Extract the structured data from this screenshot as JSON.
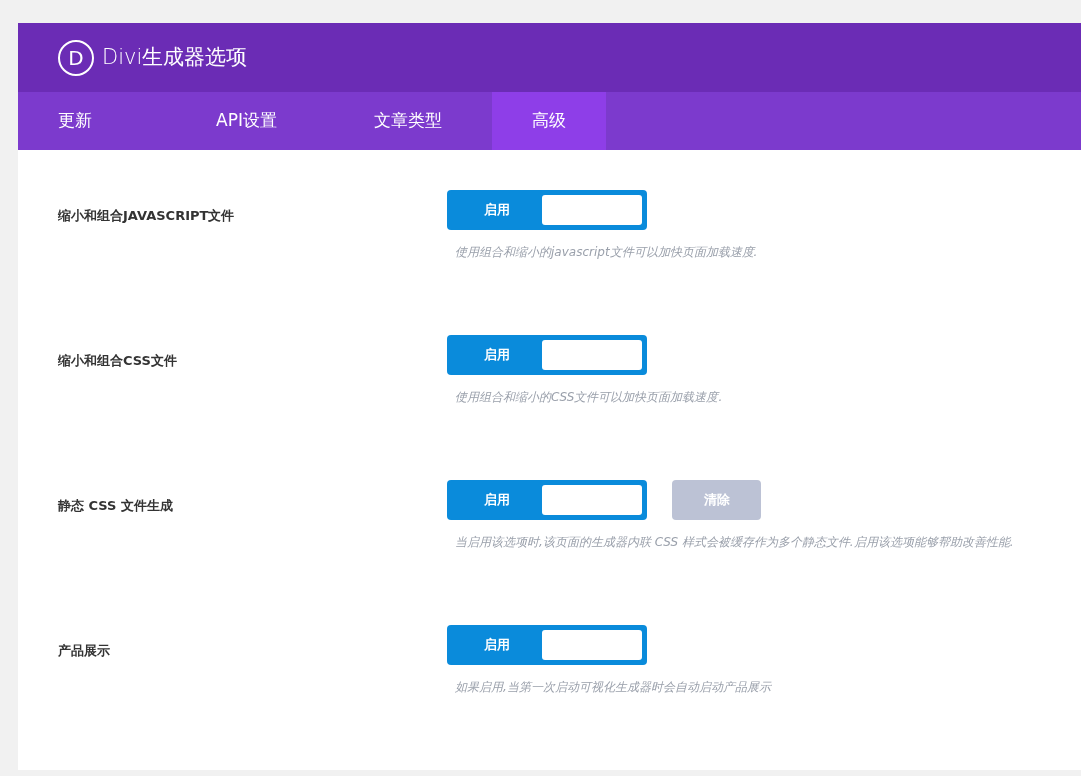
{
  "header": {
    "logo": "D",
    "title_prefix": "Divi",
    "title": "生成器选项"
  },
  "tabs": [
    {
      "label": "更新",
      "selected": false
    },
    {
      "label": "API设置",
      "selected": false
    },
    {
      "label": "文章类型",
      "selected": false
    },
    {
      "label": "高级",
      "selected": true
    }
  ],
  "settings": [
    {
      "label": "缩小和组合JAVASCRIPT文件",
      "toggle": {
        "label": "启用",
        "on": true
      },
      "description": "使用组合和缩小的javascript文件可以加快页面加载速度."
    },
    {
      "label": "缩小和组合CSS文件",
      "toggle": {
        "label": "启用",
        "on": true
      },
      "description": "使用组合和缩小的CSS文件可以加快页面加载速度."
    },
    {
      "label": "静态 CSS 文件生成",
      "toggle": {
        "label": "启用",
        "on": true
      },
      "button": {
        "label": "清除",
        "disabled": true
      },
      "description": "当启用该选项时,该页面的生成器内联 CSS 样式会被缓存作为多个静态文件.启用该选项能够帮助改善性能."
    },
    {
      "label": "产品展示",
      "toggle": {
        "label": "启用",
        "on": true
      },
      "description": "如果启用,当第一次启动可视化生成器时会自动启动产品展示"
    }
  ]
}
